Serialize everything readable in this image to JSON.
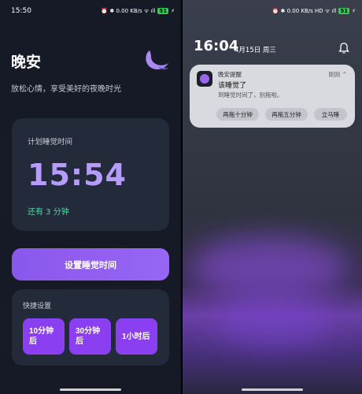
{
  "left": {
    "status": {
      "time": "15:50",
      "icons": "⏰ ✱ 0.00 KB/s ᯤ ıll",
      "battery": "51"
    },
    "app_title": "晚安",
    "subtitle": "放松心情，享受美好的夜晚时光",
    "card": {
      "label": "计划睡觉时间",
      "time": "15:54",
      "remaining": "还有 3 分钟"
    },
    "set_button": "设置睡觉时间",
    "quick": {
      "label": "快捷设置",
      "buttons": [
        "10分钟后",
        "30分钟后",
        "1小时后"
      ]
    }
  },
  "right": {
    "status": {
      "icons": "⏰ ✱ 0.00 KB/s HD ᯤ ıll",
      "battery": "51"
    },
    "clock": "16:04",
    "date": "4月15日 周三",
    "notification": {
      "app": "晚安提醒",
      "time": "刚刚 ^",
      "title": "该睡觉了",
      "body": "到睡觉时间了，别拖啦。",
      "actions": [
        "再拖十分钟",
        "再拖五分钟",
        "立马睡"
      ]
    }
  },
  "colors": {
    "accent": "#9866f4",
    "card": "#232a3a",
    "remaining": "#5ed5a3"
  }
}
